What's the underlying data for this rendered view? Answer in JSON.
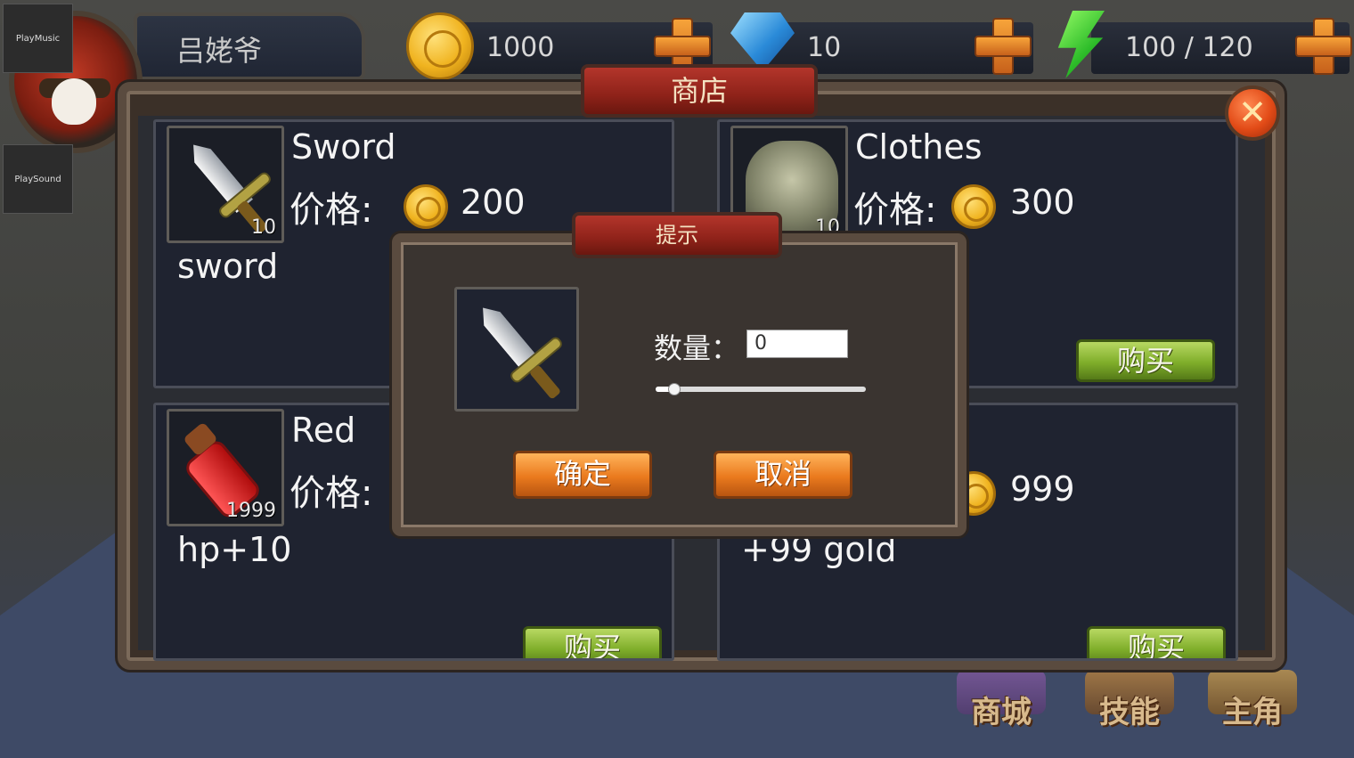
{
  "debug": {
    "play_music": "PlayMusic",
    "play_sound": "PlaySound"
  },
  "player": {
    "name": "吕姥爷"
  },
  "resources": {
    "gold": "1000",
    "gems": "10",
    "energy": "100 / 120"
  },
  "shop": {
    "title": "商店",
    "price_label": "价格:",
    "buy_label": "购买",
    "items": [
      {
        "name": "Sword",
        "price": "200",
        "count": "10",
        "desc": "sword",
        "icon": "sword-icon"
      },
      {
        "name": "Clothes",
        "price": "300",
        "count": "10",
        "desc": "",
        "icon": "armor-icon"
      },
      {
        "name": "Red",
        "price": "",
        "count": "1999",
        "desc": "hp+10",
        "icon": "potion-icon"
      },
      {
        "name": "",
        "price": "999",
        "count": "",
        "desc": "+99 gold",
        "icon": "coin-icon"
      }
    ]
  },
  "dialog": {
    "title": "提示",
    "qty_label": "数量：",
    "qty_value": "0",
    "slider_fraction": 0.08,
    "confirm": "确定",
    "cancel": "取消"
  },
  "nav": {
    "mall": "商城",
    "skills": "技能",
    "hero": "主角"
  }
}
